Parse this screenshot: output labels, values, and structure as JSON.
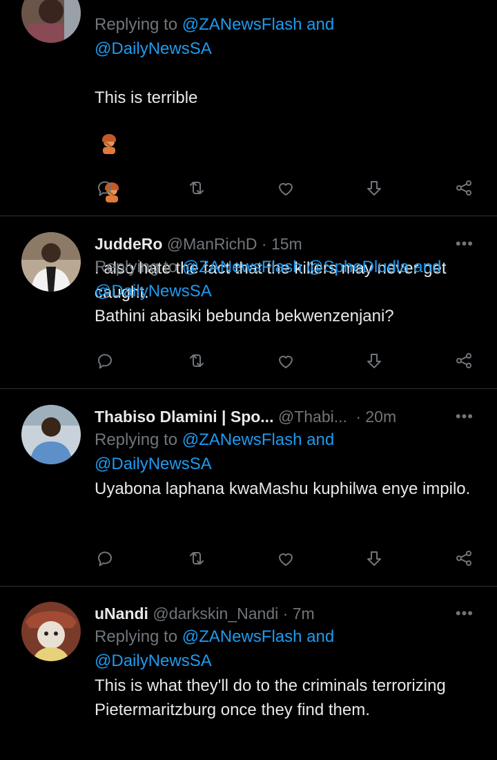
{
  "tweets": [
    {
      "reply_prefix": "Replying to",
      "reply_links": "@ZANewsFlash and",
      "reply_links2": "@DailyNewsSA",
      "text_line1": "This is terrible",
      "emoji": "facepalm-emoji",
      "text_rest": "I also hate the fact that the killers may never get caught."
    },
    {
      "name": "JuddeRo",
      "handle": "@ManRichD",
      "dot": "·",
      "time": "15m",
      "reply_prefix": "Replying to",
      "reply_links": "@ZANewsFlash @SpheDludla and",
      "reply_links2": "@DailyNewsSA",
      "text": "Bathini abasiki bebunda bekwenzenjani?"
    },
    {
      "name": "Thabiso Dlamini | Spo...",
      "handle": "@Thabi...",
      "dot": "·",
      "time": "20m",
      "reply_prefix": "Replying to",
      "reply_links": "@ZANewsFlash and",
      "reply_links2": "@DailyNewsSA",
      "text": "Uyabona laphana kwaMashu kuphilwa enye impilo."
    },
    {
      "name": "uNandi",
      "handle": "@darkskin_Nandi",
      "dot": "·",
      "time": "7m",
      "reply_prefix": "Replying to",
      "reply_links": "@ZANewsFlash and",
      "reply_links2": "@DailyNewsSA",
      "text": "This is what they'll do to the criminals terrorizing Pietermaritzburg once they find them."
    }
  ],
  "more_glyph": "•••",
  "colors": {
    "link": "#1d9bf0",
    "muted": "#71767b",
    "text": "#e7e9ea",
    "background": "#000000",
    "divider": "#2f3336"
  },
  "icons": [
    "reply-icon",
    "retweet-icon",
    "like-icon",
    "downvote-icon",
    "share-icon",
    "more-icon"
  ]
}
